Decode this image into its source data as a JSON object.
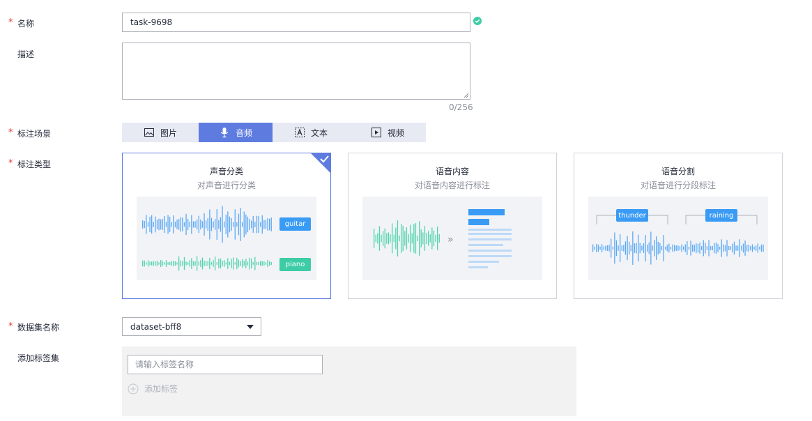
{
  "form": {
    "name": {
      "label": "名称",
      "value": "task-9698",
      "status_color": "#3dcca6"
    },
    "description": {
      "label": "描述",
      "counter": "0/256"
    },
    "scene": {
      "label": "标注场景",
      "tabs": [
        {
          "label": "图片",
          "icon": "image-icon",
          "active": false
        },
        {
          "label": "音频",
          "icon": "microphone-icon",
          "active": true
        },
        {
          "label": "文本",
          "icon": "text-icon",
          "active": false
        },
        {
          "label": "视频",
          "icon": "video-icon",
          "active": false
        }
      ]
    },
    "annotation_type": {
      "label": "标注类型",
      "cards": [
        {
          "title": "声音分类",
          "subtitle": "对声音进行分类",
          "selected": true,
          "tags": [
            "guitar",
            "piano"
          ]
        },
        {
          "title": "语音内容",
          "subtitle": "对语音内容进行标注",
          "selected": false
        },
        {
          "title": "语音分割",
          "subtitle": "对语音进行分段标注",
          "selected": false,
          "tags": [
            "thunder",
            "raining"
          ]
        }
      ]
    },
    "dataset": {
      "label": "数据集名称",
      "value": "dataset-bff8"
    },
    "label_set": {
      "label": "添加标签集",
      "placeholder": "请输入标签名称",
      "add_label": "添加标签"
    }
  },
  "colors": {
    "accent": "#5e7ce0",
    "required": "#e6373a",
    "blue_wave": "#5aa9f5",
    "green_wave": "#50d4ab",
    "chip_blue": "#3a9bf5",
    "chip_green": "#3dcca6"
  }
}
